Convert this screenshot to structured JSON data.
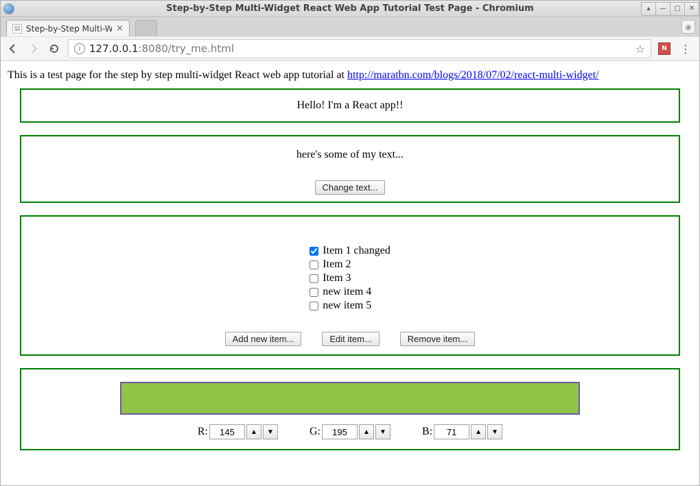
{
  "window": {
    "title": "Step-by-Step Multi-Widget React Web App Tutorial Test Page - Chromium"
  },
  "tab": {
    "title": "Step-by-Step Multi-W"
  },
  "url": {
    "host": "127.0.0.1",
    "rest": ":8080/try_me.html"
  },
  "intro": {
    "prefix": "This is a test page for the step by step multi-widget React web app tutorial at ",
    "link_text": "http://maratbn.com/blogs/2018/07/02/react-multi-widget/"
  },
  "widget1": {
    "text": "Hello! I'm a React app!!"
  },
  "widget2": {
    "text": "here's some of my text...",
    "change_btn": "Change text..."
  },
  "widget3": {
    "items": [
      {
        "label": "Item 1 changed",
        "checked": true
      },
      {
        "label": "Item 2",
        "checked": false
      },
      {
        "label": "Item 3",
        "checked": false
      },
      {
        "label": "new item 4",
        "checked": false
      },
      {
        "label": "new item 5",
        "checked": false
      }
    ],
    "add_btn": "Add new item...",
    "edit_btn": "Edit item...",
    "remove_btn": "Remove item..."
  },
  "widget4": {
    "r_label": "R:",
    "g_label": "G:",
    "b_label": "B:",
    "r": "145",
    "g": "195",
    "b": "71",
    "swatch_color": "#91c347",
    "up": "▲",
    "down": "▼"
  }
}
